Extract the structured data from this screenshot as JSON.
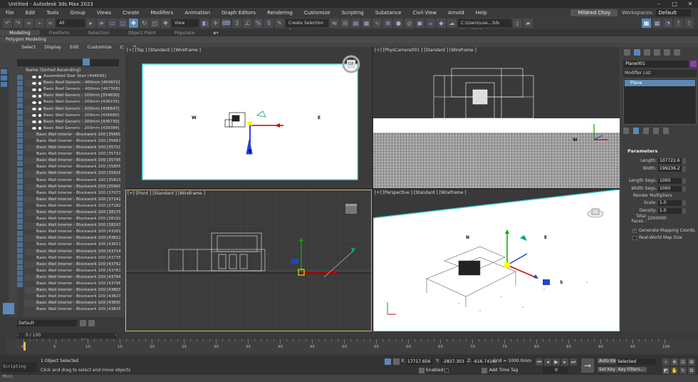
{
  "window": {
    "title": "Untitled - Autodesk 3ds Max 2023"
  },
  "menu": {
    "items": [
      "File",
      "Edit",
      "Tools",
      "Group",
      "Views",
      "Create",
      "Modifiers",
      "Animation",
      "Graph Editors",
      "Rendering",
      "Customize",
      "Scripting",
      "Substance",
      "Civil View",
      "Arnold",
      "Help"
    ],
    "user": "Mildred Choy",
    "workspaces_label": "Workspaces:",
    "workspace_value": "Default"
  },
  "toolbar": {
    "filter": "All",
    "view": "View",
    "selection_set": "Create Selection Se",
    "path": "C:\\Users\\use...3ds Max 2023"
  },
  "ribbon": {
    "tabs": [
      "Modeling",
      "Freeform",
      "Selection",
      "Object Paint",
      "Populate"
    ],
    "subtitle": "Polygon Modeling"
  },
  "explorer": {
    "tabs": [
      "Select",
      "Display",
      "Edit",
      "Customize"
    ],
    "header": "Name (Sorted Ascending)",
    "rows": [
      "Assembled Stair Stair [444093]",
      "Basic Roof Generic - 400mm [454972]",
      "Basic Roof Generic - 400mm [497308]",
      "Basic Wall Generic - 200mm [354830]",
      "Basic Wall Generic - 200mm [436235]",
      "Basic Wall Generic - 200mm [436647]",
      "Basic Wall Generic - 200mm [436680]",
      "Basic Wall Generic - 200mm [436730]",
      "Basic Wall Generic - 200mm [439384]",
      "Basic Wall Interior - Blockwork 100 [35660",
      "Basic Wall Interior - Blockwork 100 [35661",
      "Basic Wall Interior - Blockwork 100 [35710",
      "Basic Wall Interior - Blockwork 100 [35731",
      "Basic Wall Interior - Blockwork 100 [35795",
      "Basic Wall Interior - Blockwork 100 [35805",
      "Basic Wall Interior - Blockwork 100 [35816",
      "Basic Wall Interior - Blockwork 100 [35819",
      "Basic Wall Interior - Blockwork 100 [35900",
      "Basic Wall Interior - Blockwork 100 [37073",
      "Basic Wall Interior - Blockwork 100 [37142",
      "Basic Wall Interior - Blockwork 100 [37182",
      "Basic Wall Interior - Blockwork 100 [38179",
      "Basic Wall Interior - Blockwork 100 [38192",
      "Basic Wall Interior - Blockwork 100 [38203",
      "Basic Wall Interior - Blockwork 100 [43269",
      "Basic Wall Interior - Blockwork 100 [43612",
      "Basic Wall Interior - Blockwork 100 [43613",
      "Basic Wall Interior - Blockwork 100 [43714",
      "Basic Wall Interior - Blockwork 100 [43735",
      "Basic Wall Interior - Blockwork 100 [43762",
      "Basic Wall Interior - Blockwork 100 [43781",
      "Basic Wall Interior - Blockwork 100 [43794",
      "Basic Wall Interior - Blockwork 100 [43798",
      "Basic Wall Interior - Blockwork 100 [43803",
      "Basic Wall Interior - Blockwork 100 [43823",
      "Basic Wall Interior - Blockwork 100 [43830",
      "Basic Wall Interior - Blockwork 100 [43835"
    ],
    "layer": "Default"
  },
  "viewports": {
    "top": {
      "label": "[+] [Top ] [Standard ] [Wireframe ]",
      "w": "W",
      "e": "E",
      "cube": "TOP"
    },
    "cam": {
      "label": "[+] [PhysCamera001 ] [Standard ] [Wireframe ]",
      "w": "W"
    },
    "front": {
      "label": "[+] [Front ] [Standard ] [Wireframe ]"
    },
    "persp": {
      "label": "[+] [Perspective ] [Standard ] [Wireframe ]",
      "n": "N",
      "e": "E",
      "s": "S"
    }
  },
  "command": {
    "name": "Plane001",
    "color": "#8a3fb0",
    "modifier_list": "Modifier List",
    "stack_item": "Plane",
    "params_title": "Parameters",
    "length_label": "Length:",
    "length": "107722.6",
    "width_label": "Width:",
    "width": "199236.2",
    "lsegs_label": "Length Segs:",
    "lsegs": "1000",
    "wsegs_label": "Width Segs:",
    "wsegs": "1000",
    "render_mult": "Render Multipliers",
    "scale_label": "Scale:",
    "scale": "1.0",
    "density_label": "Density:",
    "density": "1.0",
    "faces_label": "Total Faces :",
    "faces": "2000000",
    "gen_map": "Generate Mapping Coords.",
    "real_world": "Real-World Map Size"
  },
  "timeline": {
    "frame": "0 / 100",
    "ticks": [
      "0",
      "5",
      "10",
      "15",
      "20",
      "25",
      "30",
      "35",
      "40",
      "45",
      "50",
      "55",
      "60",
      "65",
      "70",
      "75",
      "80",
      "85",
      "90",
      "95",
      "100"
    ]
  },
  "status": {
    "script": "Scripting Mini",
    "selected": "1 Object Selected",
    "hint": "Click and drag to select and move objects",
    "x_label": "X:",
    "x": "17717.656",
    "y_label": "Y:",
    "y": "-2837.303",
    "z_label": "Z:",
    "z": "-616.741m",
    "grid": "Grid = 1000.0mm",
    "enabled": "Enabled:",
    "add_time_tag": "Add Time Tag",
    "auto_key": "Auto Key",
    "set_key": "Set Key",
    "selected_mode": "Selected",
    "key_filters": "Key Filters...",
    "frame_num": "0"
  }
}
